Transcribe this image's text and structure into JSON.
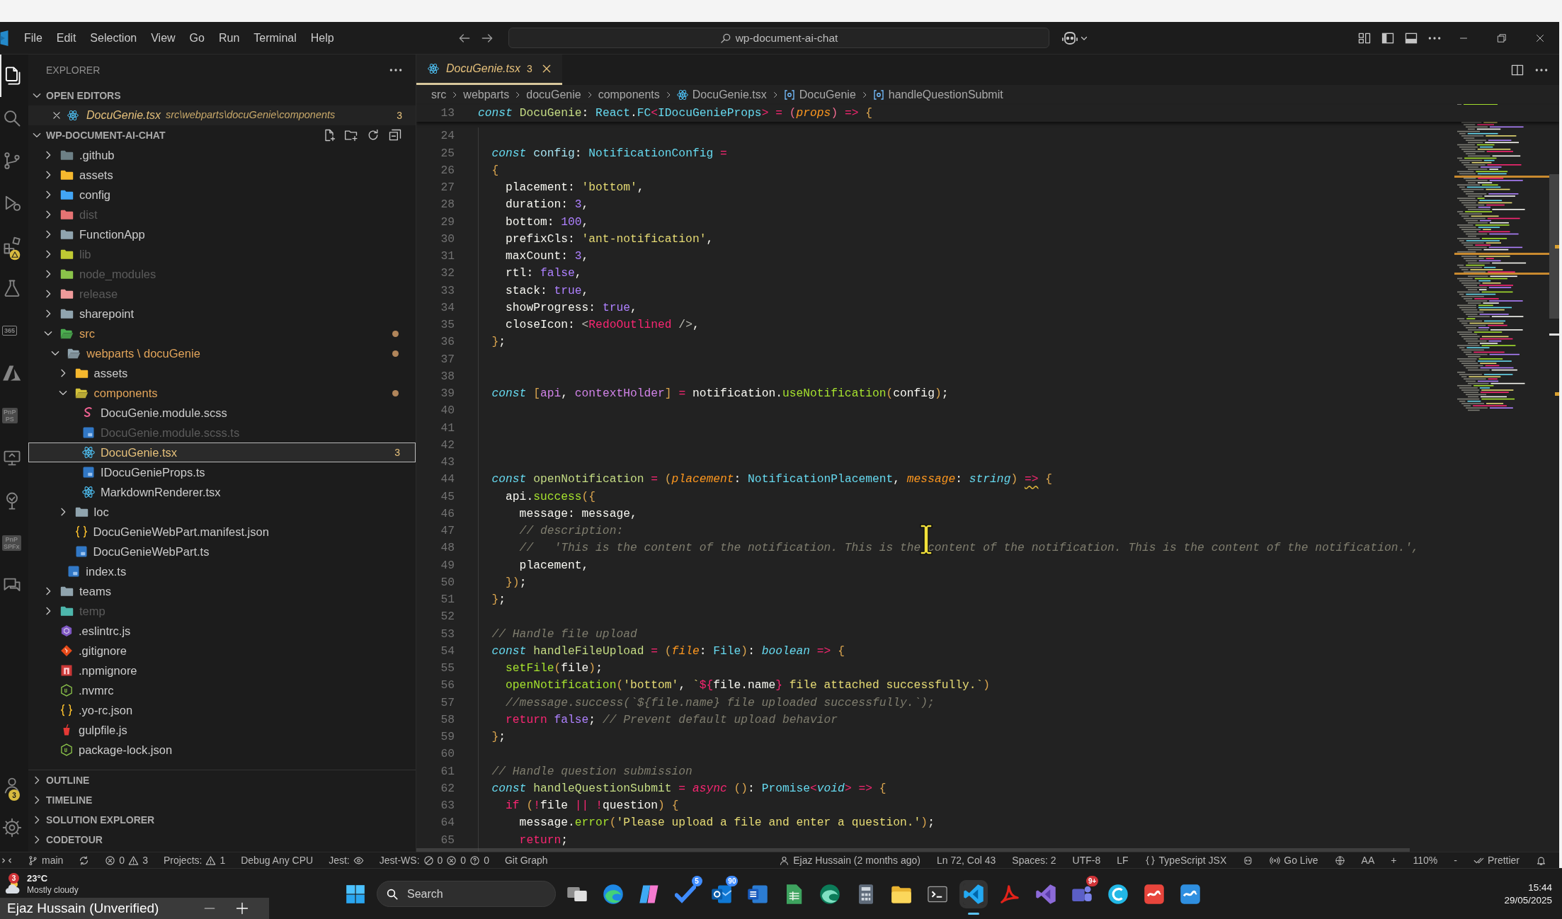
{
  "title_bar": {
    "menu": [
      "File",
      "Edit",
      "Selection",
      "View",
      "Go",
      "Run",
      "Terminal",
      "Help"
    ],
    "command_center": "wp-document-ai-chat"
  },
  "activity_bar": {
    "items": [
      {
        "kind": "explorer",
        "selected": true,
        "alert": false
      },
      {
        "kind": "search",
        "selected": false,
        "alert": false
      },
      {
        "kind": "source-control",
        "selected": false,
        "alert": false
      },
      {
        "kind": "run-debug",
        "selected": false,
        "alert": false
      },
      {
        "kind": "extensions",
        "selected": false,
        "alert": true
      },
      {
        "kind": "testing",
        "selected": false,
        "alert": false
      },
      {
        "kind": "label-box",
        "selected": false,
        "alert": false,
        "lines": [
          "365"
        ]
      },
      {
        "kind": "azure",
        "selected": false,
        "alert": false
      },
      {
        "kind": "label-tile",
        "selected": false,
        "alert": false,
        "lines": [
          "PnP",
          "PS"
        ]
      },
      {
        "kind": "remote",
        "selected": false,
        "alert": false
      },
      {
        "kind": "tree",
        "selected": false,
        "alert": false
      },
      {
        "kind": "label-tile",
        "selected": false,
        "alert": false,
        "lines": [
          "PnP",
          "SPFx"
        ]
      },
      {
        "kind": "chat",
        "selected": false,
        "alert": false
      }
    ],
    "bottom_items": [
      {
        "kind": "accounts",
        "badge": "3"
      },
      {
        "kind": "settings"
      }
    ]
  },
  "sidebar": {
    "title": "EXPLORER",
    "open_editors": {
      "title": "OPEN EDITORS",
      "expanded": true,
      "items": [
        {
          "name": "DocuGenie.tsx",
          "path": "src\\webparts\\docuGenie\\components",
          "kind": "react",
          "badge": "3",
          "warning": true
        }
      ]
    },
    "workspace": {
      "title": "WP-DOCUMENT-AI-CHAT",
      "expanded": true,
      "tree": [
        {
          "name": ".github",
          "kind": "folder",
          "color": "#6d8086",
          "expanded": false,
          "modified": false,
          "ignored": false,
          "warning": false,
          "selected": false
        },
        {
          "name": "assets",
          "kind": "folder",
          "color": "#f5b82e",
          "expanded": false,
          "modified": false,
          "ignored": false,
          "warning": false,
          "selected": false
        },
        {
          "name": "config",
          "kind": "folder",
          "color": "#42a5f5",
          "expanded": false,
          "modified": false,
          "ignored": false,
          "warning": false,
          "selected": false
        },
        {
          "name": "dist",
          "kind": "folder",
          "color": "#e57373",
          "expanded": false,
          "modified": false,
          "ignored": true,
          "warning": false,
          "selected": false
        },
        {
          "name": "FunctionApp",
          "kind": "folder",
          "color": "#90a4ae",
          "expanded": false,
          "modified": false,
          "ignored": false,
          "warning": false,
          "selected": false
        },
        {
          "name": "lib",
          "kind": "folder",
          "color": "#c0ca33",
          "expanded": false,
          "modified": false,
          "ignored": true,
          "warning": false,
          "selected": false
        },
        {
          "name": "node_modules",
          "kind": "folder",
          "color": "#8bc34a",
          "expanded": false,
          "modified": false,
          "ignored": true,
          "warning": false,
          "selected": false
        },
        {
          "name": "release",
          "kind": "folder",
          "color": "#ef9a9a",
          "expanded": false,
          "modified": false,
          "ignored": true,
          "warning": false,
          "selected": false
        },
        {
          "name": "sharepoint",
          "kind": "folder",
          "color": "#90a4ae",
          "expanded": false,
          "modified": false,
          "ignored": false,
          "warning": false,
          "selected": false
        },
        {
          "name": "src",
          "kind": "folder",
          "color": "#4caf50",
          "expanded": true,
          "modified": true,
          "ignored": false,
          "warning": false,
          "selected": false,
          "children": [
            {
              "name": "webparts \\ docuGenie",
              "kind": "folder",
              "color": "#90a4ae",
              "expanded": true,
              "modified": true,
              "ignored": false,
              "warning": false,
              "selected": false,
              "children": [
                {
                  "name": "assets",
                  "kind": "folder",
                  "color": "#f5b82e",
                  "expanded": false,
                  "modified": false,
                  "ignored": false,
                  "warning": false,
                  "selected": false
                },
                {
                  "name": "components",
                  "kind": "folder",
                  "color": "#d4c23a",
                  "expanded": true,
                  "modified": true,
                  "ignored": false,
                  "warning": false,
                  "selected": false,
                  "children": [
                    {
                      "name": "DocuGenie.module.scss",
                      "kind": "scss",
                      "modified": false,
                      "ignored": false,
                      "warning": false,
                      "selected": false
                    },
                    {
                      "name": "DocuGenie.module.scss.ts",
                      "kind": "ts",
                      "modified": false,
                      "ignored": true,
                      "warning": false,
                      "selected": false
                    },
                    {
                      "name": "DocuGenie.tsx",
                      "kind": "react",
                      "modified": false,
                      "ignored": false,
                      "warning": true,
                      "selected": true,
                      "badge": "3"
                    },
                    {
                      "name": "IDocuGenieProps.ts",
                      "kind": "ts",
                      "modified": false,
                      "ignored": false,
                      "warning": false,
                      "selected": false
                    },
                    {
                      "name": "MarkdownRenderer.tsx",
                      "kind": "react",
                      "modified": false,
                      "ignored": false,
                      "warning": false,
                      "selected": false
                    }
                  ]
                },
                {
                  "name": "loc",
                  "kind": "folder",
                  "color": "#90a4ae",
                  "expanded": false,
                  "modified": false,
                  "ignored": false,
                  "warning": false,
                  "selected": false
                },
                {
                  "name": "DocuGenieWebPart.manifest.json",
                  "kind": "json",
                  "modified": false,
                  "ignored": false,
                  "warning": false,
                  "selected": false
                },
                {
                  "name": "DocuGenieWebPart.ts",
                  "kind": "ts",
                  "modified": false,
                  "ignored": false,
                  "warning": false,
                  "selected": false
                }
              ]
            },
            {
              "name": "index.ts",
              "kind": "ts",
              "modified": false,
              "ignored": false,
              "warning": false,
              "selected": false
            }
          ]
        },
        {
          "name": "teams",
          "kind": "folder",
          "color": "#90a4ae",
          "expanded": false,
          "modified": false,
          "ignored": false,
          "warning": false,
          "selected": false
        },
        {
          "name": "temp",
          "kind": "folder",
          "color": "#4db6ac",
          "expanded": false,
          "modified": false,
          "ignored": true,
          "warning": false,
          "selected": false
        },
        {
          "name": ".eslintrc.js",
          "kind": "eslint",
          "modified": false,
          "ignored": false,
          "warning": false,
          "selected": false
        },
        {
          "name": ".gitignore",
          "kind": "git",
          "modified": false,
          "ignored": false,
          "warning": false,
          "selected": false
        },
        {
          "name": ".npmignore",
          "kind": "npm",
          "modified": false,
          "ignored": false,
          "warning": false,
          "selected": false
        },
        {
          "name": ".nvmrc",
          "kind": "node",
          "modified": false,
          "ignored": false,
          "warning": false,
          "selected": false
        },
        {
          "name": ".yo-rc.json",
          "kind": "json",
          "modified": false,
          "ignored": false,
          "warning": false,
          "selected": false
        },
        {
          "name": "gulpfile.js",
          "kind": "gulp",
          "modified": false,
          "ignored": false,
          "warning": false,
          "selected": false
        },
        {
          "name": "package-lock.json",
          "kind": "node",
          "modified": false,
          "ignored": false,
          "warning": false,
          "selected": false
        }
      ]
    },
    "panels": [
      {
        "title": "OUTLINE",
        "expanded": false
      },
      {
        "title": "TIMELINE",
        "expanded": false
      },
      {
        "title": "SOLUTION EXPLORER",
        "expanded": false
      },
      {
        "title": "CODETOUR",
        "expanded": false
      }
    ]
  },
  "editor": {
    "tabs": [
      {
        "name": "DocuGenie.tsx",
        "kind": "react",
        "badge": "3",
        "selected": true
      }
    ],
    "breadcrumbs": [
      {
        "text": "src",
        "kind": "folder"
      },
      {
        "text": "webparts",
        "kind": "folder"
      },
      {
        "text": "docuGenie",
        "kind": "folder"
      },
      {
        "text": "components",
        "kind": "folder"
      },
      {
        "text": "DocuGenie.tsx",
        "kind": "react"
      },
      {
        "text": "DocuGenie",
        "kind": "symbol"
      },
      {
        "text": "handleQuestionSubmit",
        "kind": "symbol"
      }
    ],
    "sticky_line": {
      "number": "13",
      "tokens": [
        {
          "kind": "decl",
          "text": "const "
        },
        {
          "kind": "name",
          "text": "DocuGenie"
        },
        {
          "kind": "plain",
          "text": ": "
        },
        {
          "kind": "type",
          "text": "React"
        },
        {
          "kind": "plain",
          "text": "."
        },
        {
          "kind": "type",
          "text": "FC"
        },
        {
          "kind": "op",
          "text": "<"
        },
        {
          "kind": "type",
          "text": "IDocuGenieProps"
        },
        {
          "kind": "op",
          "text": "> = "
        },
        {
          "kind": "paren",
          "text": "("
        },
        {
          "kind": "param",
          "text": "props"
        },
        {
          "kind": "paren",
          "text": ") "
        },
        {
          "kind": "op",
          "text": "=> "
        },
        {
          "kind": "brace",
          "text": "{"
        }
      ]
    },
    "lines": [
      {
        "number": "24"
      },
      {
        "number": "25",
        "tokens": [
          {
            "kind": "decl",
            "text": "  const "
          },
          {
            "kind": "var",
            "text": "config"
          },
          {
            "kind": "plain",
            "text": ": "
          },
          {
            "kind": "type",
            "text": "NotificationConfig "
          },
          {
            "kind": "op",
            "text": "="
          }
        ]
      },
      {
        "number": "26",
        "tokens": [
          {
            "kind": "brace",
            "text": "  {"
          }
        ]
      },
      {
        "number": "27",
        "tokens": [
          {
            "kind": "plain",
            "text": "    placement: "
          },
          {
            "kind": "str",
            "text": "'bottom'"
          },
          {
            "kind": "plain",
            "text": ","
          }
        ]
      },
      {
        "number": "28",
        "tokens": [
          {
            "kind": "plain",
            "text": "    duration: "
          },
          {
            "kind": "num",
            "text": "3"
          },
          {
            "kind": "plain",
            "text": ","
          }
        ]
      },
      {
        "number": "29",
        "tokens": [
          {
            "kind": "plain",
            "text": "    bottom: "
          },
          {
            "kind": "num",
            "text": "100"
          },
          {
            "kind": "plain",
            "text": ","
          }
        ]
      },
      {
        "number": "30",
        "tokens": [
          {
            "kind": "plain",
            "text": "    prefixCls: "
          },
          {
            "kind": "str",
            "text": "'ant-notification'"
          },
          {
            "kind": "plain",
            "text": ","
          }
        ]
      },
      {
        "number": "31",
        "tokens": [
          {
            "kind": "plain",
            "text": "    maxCount: "
          },
          {
            "kind": "num",
            "text": "3"
          },
          {
            "kind": "plain",
            "text": ","
          }
        ]
      },
      {
        "number": "32",
        "tokens": [
          {
            "kind": "plain",
            "text": "    rtl: "
          },
          {
            "kind": "num",
            "text": "false"
          },
          {
            "kind": "plain",
            "text": ","
          }
        ]
      },
      {
        "number": "33",
        "tokens": [
          {
            "kind": "plain",
            "text": "    stack: "
          },
          {
            "kind": "num",
            "text": "true"
          },
          {
            "kind": "plain",
            "text": ","
          }
        ]
      },
      {
        "number": "34",
        "tokens": [
          {
            "kind": "plain",
            "text": "    showProgress: "
          },
          {
            "kind": "num",
            "text": "true"
          },
          {
            "kind": "plain",
            "text": ","
          }
        ]
      },
      {
        "number": "35",
        "tokens": [
          {
            "kind": "plain",
            "text": "    closeIcon: "
          },
          {
            "kind": "punc",
            "text": "<"
          },
          {
            "kind": "tag",
            "text": "RedoOutlined"
          },
          {
            "kind": "punc",
            "text": " />"
          },
          {
            "kind": "plain",
            "text": ","
          }
        ]
      },
      {
        "number": "36",
        "tokens": [
          {
            "kind": "brace",
            "text": "  }"
          },
          {
            "kind": "plain",
            "text": ";"
          }
        ]
      },
      {
        "number": "37"
      },
      {
        "number": "38"
      },
      {
        "number": "39",
        "tokens": [
          {
            "kind": "decl",
            "text": "  const "
          },
          {
            "kind": "brace",
            "text": "["
          },
          {
            "kind": "bind",
            "text": "api"
          },
          {
            "kind": "plain",
            "text": ", "
          },
          {
            "kind": "bind",
            "text": "contextHolder"
          },
          {
            "kind": "brace",
            "text": "] "
          },
          {
            "kind": "op",
            "text": "= "
          },
          {
            "kind": "plain",
            "text": "notification."
          },
          {
            "kind": "fn",
            "text": "useNotification"
          },
          {
            "kind": "brace",
            "text": "("
          },
          {
            "kind": "plain",
            "text": "config"
          },
          {
            "kind": "brace",
            "text": ")"
          },
          {
            "kind": "plain",
            "text": ";"
          }
        ]
      },
      {
        "number": "40"
      },
      {
        "number": "41"
      },
      {
        "number": "42"
      },
      {
        "number": "43"
      },
      {
        "number": "44",
        "tokens": [
          {
            "kind": "decl",
            "text": "  const "
          },
          {
            "kind": "name",
            "text": "openNotification "
          },
          {
            "kind": "op",
            "text": "= "
          },
          {
            "kind": "brace",
            "text": "("
          },
          {
            "kind": "param",
            "text": "placement"
          },
          {
            "kind": "plain",
            "text": ": "
          },
          {
            "kind": "type",
            "text": "NotificationPlacement"
          },
          {
            "kind": "plain",
            "text": ", "
          },
          {
            "kind": "param",
            "text": "message"
          },
          {
            "kind": "plain",
            "text": ": "
          },
          {
            "kind": "typei",
            "text": "string"
          },
          {
            "kind": "brace",
            "text": ") "
          },
          {
            "kind": "warnop",
            "text": "=>"
          },
          {
            "kind": "brace",
            "text": " {"
          }
        ]
      },
      {
        "number": "45",
        "tokens": [
          {
            "kind": "plain",
            "text": "    api."
          },
          {
            "kind": "fn",
            "text": "success"
          },
          {
            "kind": "brace",
            "text": "({"
          }
        ]
      },
      {
        "number": "46",
        "tokens": [
          {
            "kind": "plain",
            "text": "      message: message,"
          }
        ]
      },
      {
        "number": "47",
        "tokens": [
          {
            "kind": "cmt",
            "text": "      // description:"
          }
        ]
      },
      {
        "number": "48",
        "tokens": [
          {
            "kind": "cmt",
            "text": "      //   'This is the content of the notification. This is the content of the notification. This is the content of the notification.',"
          }
        ]
      },
      {
        "number": "49",
        "tokens": [
          {
            "kind": "plain",
            "text": "      placement,"
          }
        ]
      },
      {
        "number": "50",
        "tokens": [
          {
            "kind": "brace",
            "text": "    })"
          },
          {
            "kind": "plain",
            "text": ";"
          }
        ]
      },
      {
        "number": "51",
        "tokens": [
          {
            "kind": "brace",
            "text": "  }"
          },
          {
            "kind": "plain",
            "text": ";"
          }
        ]
      },
      {
        "number": "52"
      },
      {
        "number": "53",
        "tokens": [
          {
            "kind": "cmt",
            "text": "  // Handle file upload"
          }
        ]
      },
      {
        "number": "54",
        "tokens": [
          {
            "kind": "decl",
            "text": "  const "
          },
          {
            "kind": "name",
            "text": "handleFileUpload "
          },
          {
            "kind": "op",
            "text": "= "
          },
          {
            "kind": "brace",
            "text": "("
          },
          {
            "kind": "param",
            "text": "file"
          },
          {
            "kind": "plain",
            "text": ": "
          },
          {
            "kind": "type",
            "text": "File"
          },
          {
            "kind": "brace",
            "text": ")"
          },
          {
            "kind": "plain",
            "text": ": "
          },
          {
            "kind": "typei",
            "text": "boolean "
          },
          {
            "kind": "op",
            "text": "=> "
          },
          {
            "kind": "brace",
            "text": "{"
          }
        ]
      },
      {
        "number": "55",
        "tokens": [
          {
            "kind": "fn",
            "text": "    setFile"
          },
          {
            "kind": "brace",
            "text": "("
          },
          {
            "kind": "plain",
            "text": "file"
          },
          {
            "kind": "brace",
            "text": ")"
          },
          {
            "kind": "plain",
            "text": ";"
          }
        ]
      },
      {
        "number": "56",
        "tokens": [
          {
            "kind": "fn",
            "text": "    openNotification"
          },
          {
            "kind": "brace",
            "text": "("
          },
          {
            "kind": "str",
            "text": "'bottom'"
          },
          {
            "kind": "plain",
            "text": ", "
          },
          {
            "kind": "str",
            "text": "`"
          },
          {
            "kind": "op",
            "text": "${"
          },
          {
            "kind": "plain",
            "text": "file.name"
          },
          {
            "kind": "op",
            "text": "}"
          },
          {
            "kind": "str",
            "text": " file attached successfully.`"
          },
          {
            "kind": "brace",
            "text": ")"
          }
        ]
      },
      {
        "number": "57",
        "tokens": [
          {
            "kind": "cmt",
            "text": "    //message.success(`${file.name} file uploaded successfully.`);"
          }
        ]
      },
      {
        "number": "58",
        "tokens": [
          {
            "kind": "op",
            "text": "    return "
          },
          {
            "kind": "num",
            "text": "false"
          },
          {
            "kind": "plain",
            "text": "; "
          },
          {
            "kind": "cmt",
            "text": "// Prevent default upload behavior"
          }
        ]
      },
      {
        "number": "59",
        "tokens": [
          {
            "kind": "brace",
            "text": "  }"
          },
          {
            "kind": "plain",
            "text": ";"
          }
        ]
      },
      {
        "number": "60"
      },
      {
        "number": "61",
        "tokens": [
          {
            "kind": "cmt",
            "text": "  // Handle question submission"
          }
        ]
      },
      {
        "number": "62",
        "tokens": [
          {
            "kind": "decl",
            "text": "  const "
          },
          {
            "kind": "name",
            "text": "handleQuestionSubmit "
          },
          {
            "kind": "op",
            "text": "= "
          },
          {
            "kind": "opi",
            "text": "async "
          },
          {
            "kind": "brace",
            "text": "()"
          },
          {
            "kind": "plain",
            "text": ": "
          },
          {
            "kind": "type",
            "text": "Promise"
          },
          {
            "kind": "op",
            "text": "<"
          },
          {
            "kind": "typei",
            "text": "void"
          },
          {
            "kind": "op",
            "text": "> => "
          },
          {
            "kind": "brace",
            "text": "{"
          }
        ]
      },
      {
        "number": "63",
        "tokens": [
          {
            "kind": "op",
            "text": "    if "
          },
          {
            "kind": "brace",
            "text": "("
          },
          {
            "kind": "op",
            "text": "!"
          },
          {
            "kind": "plain",
            "text": "file "
          },
          {
            "kind": "op",
            "text": "|| !"
          },
          {
            "kind": "plain",
            "text": "question"
          },
          {
            "kind": "brace",
            "text": ") {"
          }
        ]
      },
      {
        "number": "64",
        "tokens": [
          {
            "kind": "plain",
            "text": "      message."
          },
          {
            "kind": "fn",
            "text": "error"
          },
          {
            "kind": "brace",
            "text": "("
          },
          {
            "kind": "str",
            "text": "'Please upload a file and enter a question.'"
          },
          {
            "kind": "brace",
            "text": ")"
          },
          {
            "kind": "plain",
            "text": ";"
          }
        ]
      },
      {
        "number": "65",
        "tokens": [
          {
            "kind": "op",
            "text": "      return"
          },
          {
            "kind": "plain",
            "text": ";"
          }
        ]
      }
    ]
  },
  "status_bar": {
    "left": [
      {
        "kind": "remote"
      },
      {
        "kind": "branch",
        "text": "main"
      },
      {
        "kind": "sync"
      },
      {
        "kind": "problems",
        "errors": "0",
        "warnings": "3"
      },
      {
        "kind": "projects",
        "text": "Projects:",
        "count": "1"
      },
      {
        "kind": "plain",
        "text": "Debug Any CPU"
      },
      {
        "kind": "jest",
        "text": "Jest:"
      },
      {
        "kind": "jest-ws",
        "text": "Jest-WS:",
        "passed": "0",
        "failed": "0",
        "unknown": "0"
      },
      {
        "kind": "plain",
        "text": "Git Graph"
      }
    ],
    "right": [
      {
        "kind": "blame",
        "text": "Ejaz Hussain (2 months ago)"
      },
      {
        "kind": "plain",
        "text": "Ln 72, Col 43"
      },
      {
        "kind": "plain",
        "text": "Spaces: 2"
      },
      {
        "kind": "plain",
        "text": "UTF-8"
      },
      {
        "kind": "plain",
        "text": "LF"
      },
      {
        "kind": "language",
        "text": "TypeScript JSX"
      },
      {
        "kind": "copilot"
      },
      {
        "kind": "live",
        "text": "Go Live"
      },
      {
        "kind": "globe"
      },
      {
        "kind": "plain",
        "text": "AA"
      },
      {
        "kind": "plain",
        "text": "+"
      },
      {
        "kind": "plain",
        "text": "110%"
      },
      {
        "kind": "plain",
        "text": "-"
      },
      {
        "kind": "prettier",
        "text": "Prettier"
      },
      {
        "kind": "bell"
      }
    ]
  },
  "taskbar": {
    "weather": {
      "temperature": "23°C",
      "condition": "Mostly cloudy",
      "badge": "3"
    },
    "search": {
      "placeholder": "Search"
    },
    "apps": [
      {
        "kind": "task-view",
        "selected": false
      },
      {
        "kind": "edge",
        "selected": false
      },
      {
        "kind": "copilot",
        "selected": false
      },
      {
        "kind": "check",
        "selected": false,
        "badge": "5"
      },
      {
        "kind": "outlook",
        "selected": false,
        "badge": "90"
      },
      {
        "kind": "word",
        "selected": false
      },
      {
        "kind": "sheet",
        "selected": false
      },
      {
        "kind": "edge-dev",
        "selected": false
      },
      {
        "kind": "calculator",
        "selected": false
      },
      {
        "kind": "files",
        "selected": false
      },
      {
        "kind": "terminal",
        "selected": false
      },
      {
        "kind": "vscode",
        "selected": true
      },
      {
        "kind": "pdf",
        "selected": false
      },
      {
        "kind": "visual-studio",
        "selected": false
      },
      {
        "kind": "teams",
        "selected": false,
        "badge": "9+"
      },
      {
        "kind": "c-app",
        "selected": false
      },
      {
        "kind": "s-red",
        "selected": false
      },
      {
        "kind": "s-blue",
        "selected": false
      }
    ],
    "clock": {
      "time": "15:44",
      "date": "29/05/2025"
    }
  },
  "overlay_window": {
    "title": "Ejaz Hussain (Unverified)"
  }
}
